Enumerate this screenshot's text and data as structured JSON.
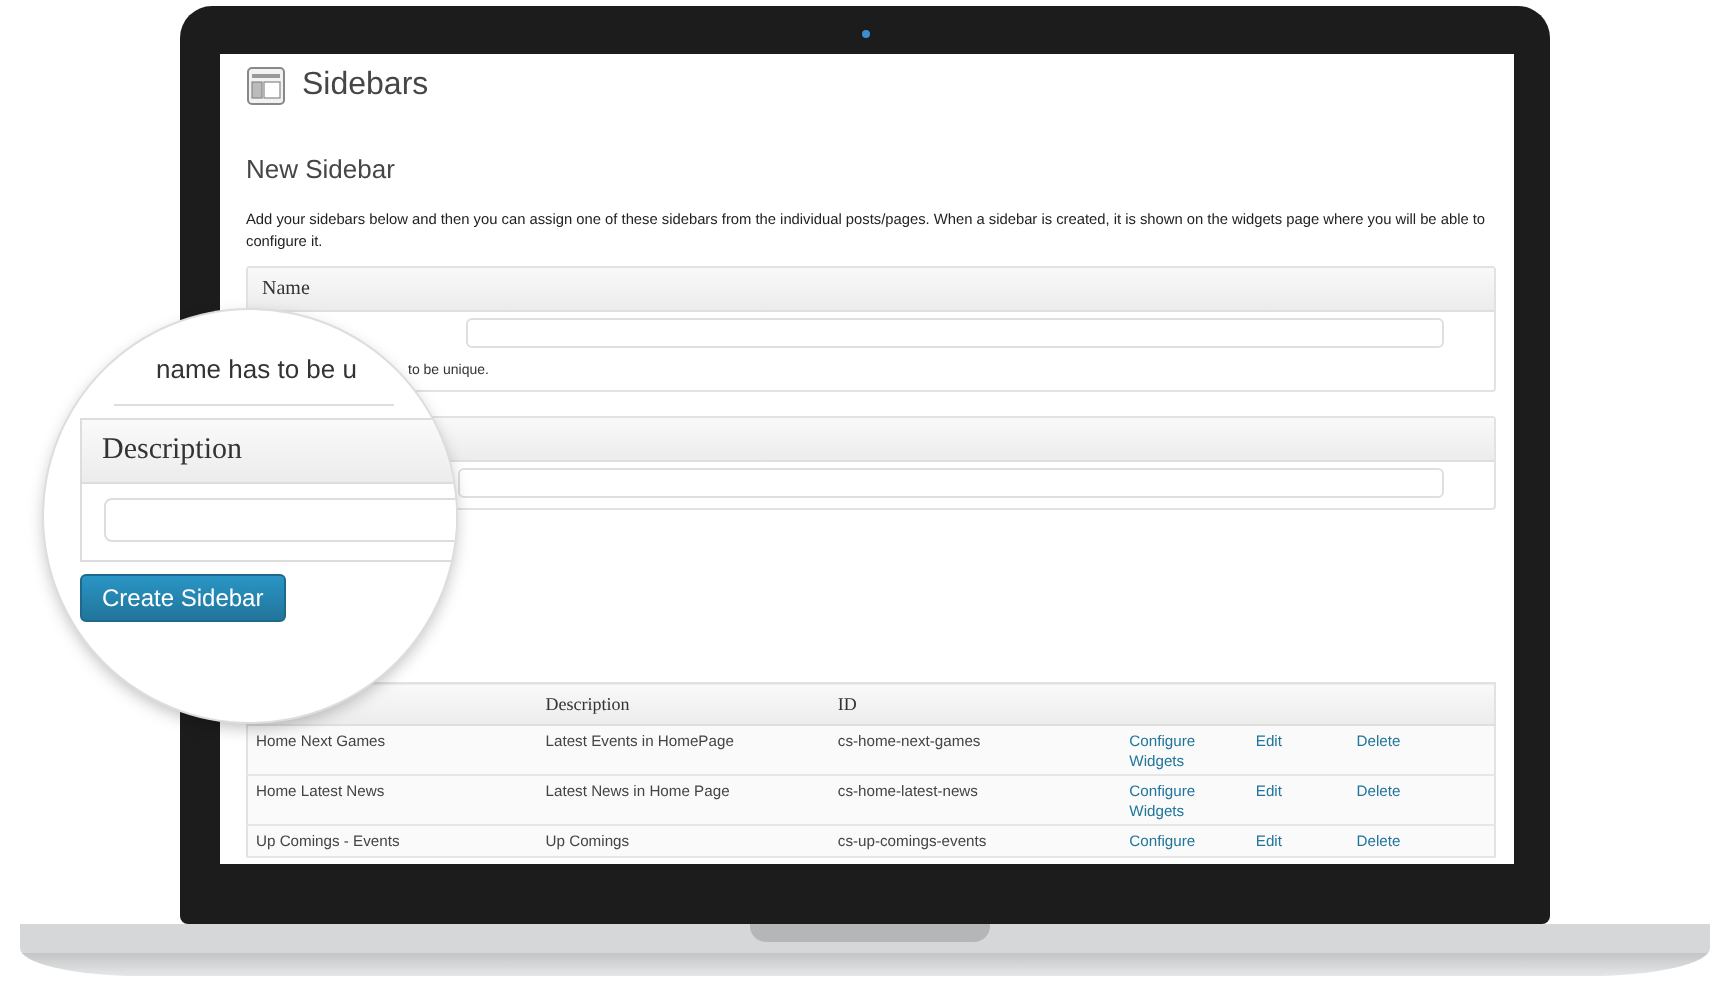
{
  "page": {
    "title": "Sidebars",
    "section_title": "New Sidebar",
    "intro": "Add your sidebars below and then you can assign one of these sidebars from the individual posts/pages. When a sidebar is created, it is shown on the widgets page where you will be able to configure it.",
    "name_box": {
      "label": "Name",
      "hint": "to be unique."
    },
    "table": {
      "columns": [
        "Description",
        "ID"
      ],
      "rows": [
        {
          "name": "Home Next Games",
          "description": "Latest Events in HomePage",
          "id": "cs-home-next-games",
          "configure": "Configure Widgets",
          "edit": "Edit",
          "delete": "Delete"
        },
        {
          "name": "Home Latest News",
          "description": "Latest News in Home Page",
          "id": "cs-home-latest-news",
          "configure": "Configure Widgets",
          "edit": "Edit",
          "delete": "Delete"
        },
        {
          "name": "Up Comings - Events",
          "description": "Up Comings",
          "id": "cs-up-comings-events",
          "configure": "Configure",
          "edit": "Edit",
          "delete": "Delete"
        }
      ]
    }
  },
  "magnifier": {
    "hint": "name has to be u",
    "description_label": "Description",
    "button": "Create Sidebar"
  }
}
